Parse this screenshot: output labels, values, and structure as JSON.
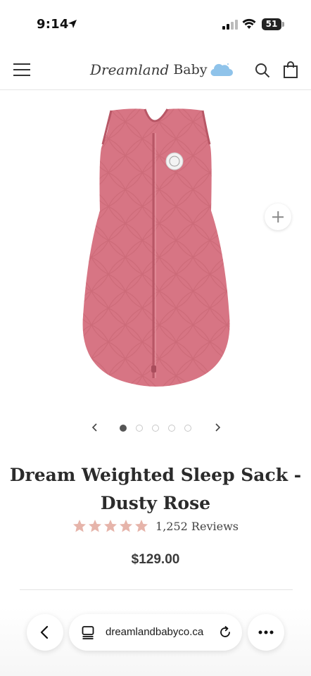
{
  "status_bar": {
    "time": "9:14",
    "battery": "51",
    "icons": [
      "location-arrow-icon",
      "signal-icon",
      "wifi-icon",
      "battery-icon"
    ]
  },
  "header": {
    "logo_script": "Dreamland",
    "logo_word": "Baby",
    "icons": [
      "menu-icon",
      "cloud-logo-icon",
      "search-icon",
      "cart-icon"
    ]
  },
  "gallery": {
    "image_name": "dusty-rose-sleep-sack",
    "slide_count": 5,
    "active_slide": 1,
    "icons": [
      "zoom-plus-icon",
      "chevron-left-icon",
      "chevron-right-icon"
    ]
  },
  "product": {
    "title_line1": "Dream Weighted Sleep Sack -",
    "title_line2": "Dusty Rose",
    "rating": 5,
    "reviews": "1,252 Reviews",
    "price": "$129.00"
  },
  "browser": {
    "url": "dreamlandbabyco.ca",
    "icons": [
      "back-chevron-icon",
      "tabs-icon",
      "reload-icon",
      "more-icon"
    ]
  },
  "colors": {
    "product": "#d77584",
    "star": "#e6b4aa",
    "logo_cloud": "#8fc3ea"
  }
}
